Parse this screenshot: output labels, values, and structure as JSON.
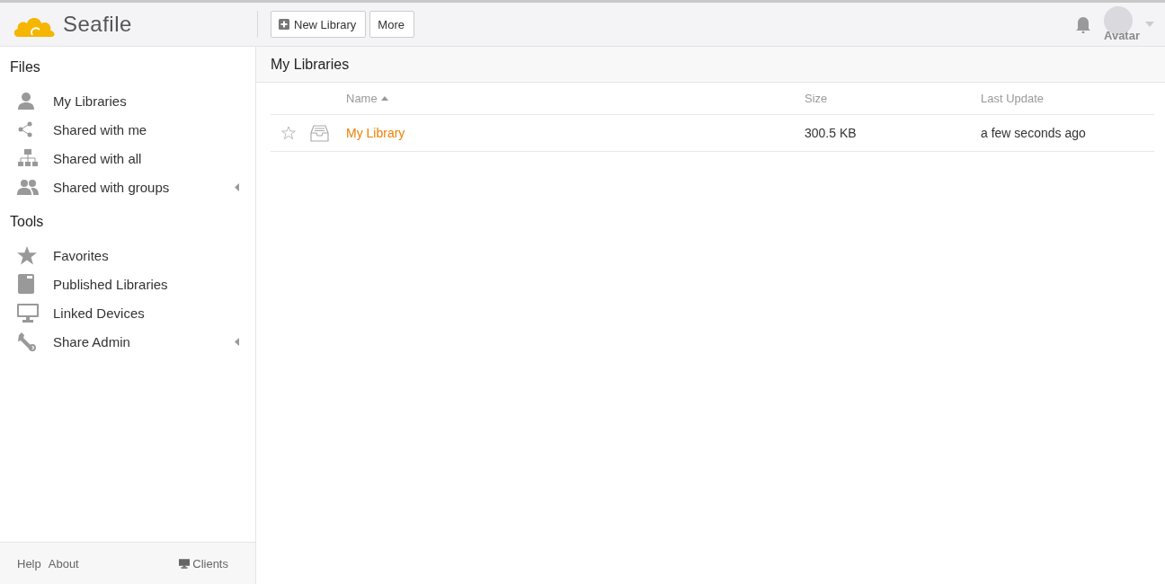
{
  "header": {
    "logo": "Seafile",
    "buttons": [
      {
        "label": "New Library",
        "kind": "add"
      },
      {
        "label": "More",
        "kind": "plain"
      }
    ],
    "avatar": {
      "alt": "Avatar"
    }
  },
  "sidebar": {
    "sections": [
      {
        "title": "Files",
        "items": [
          {
            "label": "My Libraries",
            "kind": "user",
            "expandable": false
          },
          {
            "label": "Shared with me",
            "kind": "share",
            "expandable": false
          },
          {
            "label": "Shared with all",
            "kind": "org",
            "expandable": false
          },
          {
            "label": "Shared with groups",
            "kind": "group",
            "expandable": true
          }
        ]
      },
      {
        "title": "Tools",
        "items": [
          {
            "label": "Favorites",
            "kind": "star",
            "expandable": false
          },
          {
            "label": "Published Libraries",
            "kind": "book",
            "expandable": false
          },
          {
            "label": "Linked Devices",
            "kind": "monitor",
            "expandable": false
          },
          {
            "label": "Share Admin",
            "kind": "wrench",
            "expandable": true
          }
        ]
      }
    ],
    "footer": {
      "links": [
        "Help",
        "About"
      ],
      "clients": "Clients"
    }
  },
  "main": {
    "title": "My Libraries",
    "table": {
      "columns": [
        {
          "label": "Name",
          "sorted": true
        },
        {
          "label": "Size",
          "sorted": false
        },
        {
          "label": "Last Update",
          "sorted": false
        }
      ],
      "rows": [
        {
          "starred": false,
          "name": "My Library",
          "size": "300.5 KB",
          "updated": "a few seconds ago"
        }
      ]
    }
  }
}
